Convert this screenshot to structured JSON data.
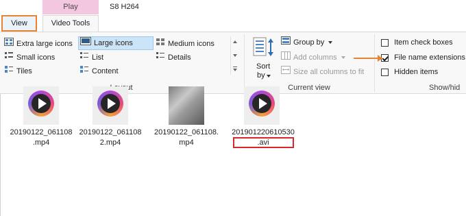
{
  "title": {
    "context_tab": "Play",
    "window_title": "S8 H264"
  },
  "tabs": {
    "view": "View",
    "video_tools": "Video Tools"
  },
  "layout": {
    "items": {
      "extra_large": "Extra large icons",
      "large": "Large icons",
      "medium": "Medium icons",
      "small": "Small icons",
      "list": "List",
      "details": "Details",
      "tiles": "Tiles",
      "content": "Content"
    },
    "label": "Layout"
  },
  "current_view": {
    "sort_line1": "Sort",
    "sort_line2": "by",
    "group_by": "Group by",
    "add_columns": "Add columns",
    "size_all": "Size all columns to fit",
    "label": "Current view"
  },
  "show_hide": {
    "item_check_boxes": "Item check boxes",
    "file_name_extensions": "File name extensions",
    "hidden_items": "Hidden items",
    "label": "Show/hid",
    "states": {
      "item_check_boxes": false,
      "file_name_extensions": true,
      "hidden_items": false
    }
  },
  "files": [
    {
      "line1": "20190122_061108",
      "line2": ".mp4"
    },
    {
      "line1": "20190122_061108",
      "line2": "2.mp4"
    },
    {
      "line1": "20190122_061108.",
      "line2": "mp4"
    },
    {
      "line1": "20190122061053​0",
      "line2": ".avi"
    }
  ],
  "colors": {
    "accent": "#e8842f",
    "highlight_box": "#d6262e",
    "selection": "#cce4f7",
    "context_tab": "#f4c7e0"
  }
}
